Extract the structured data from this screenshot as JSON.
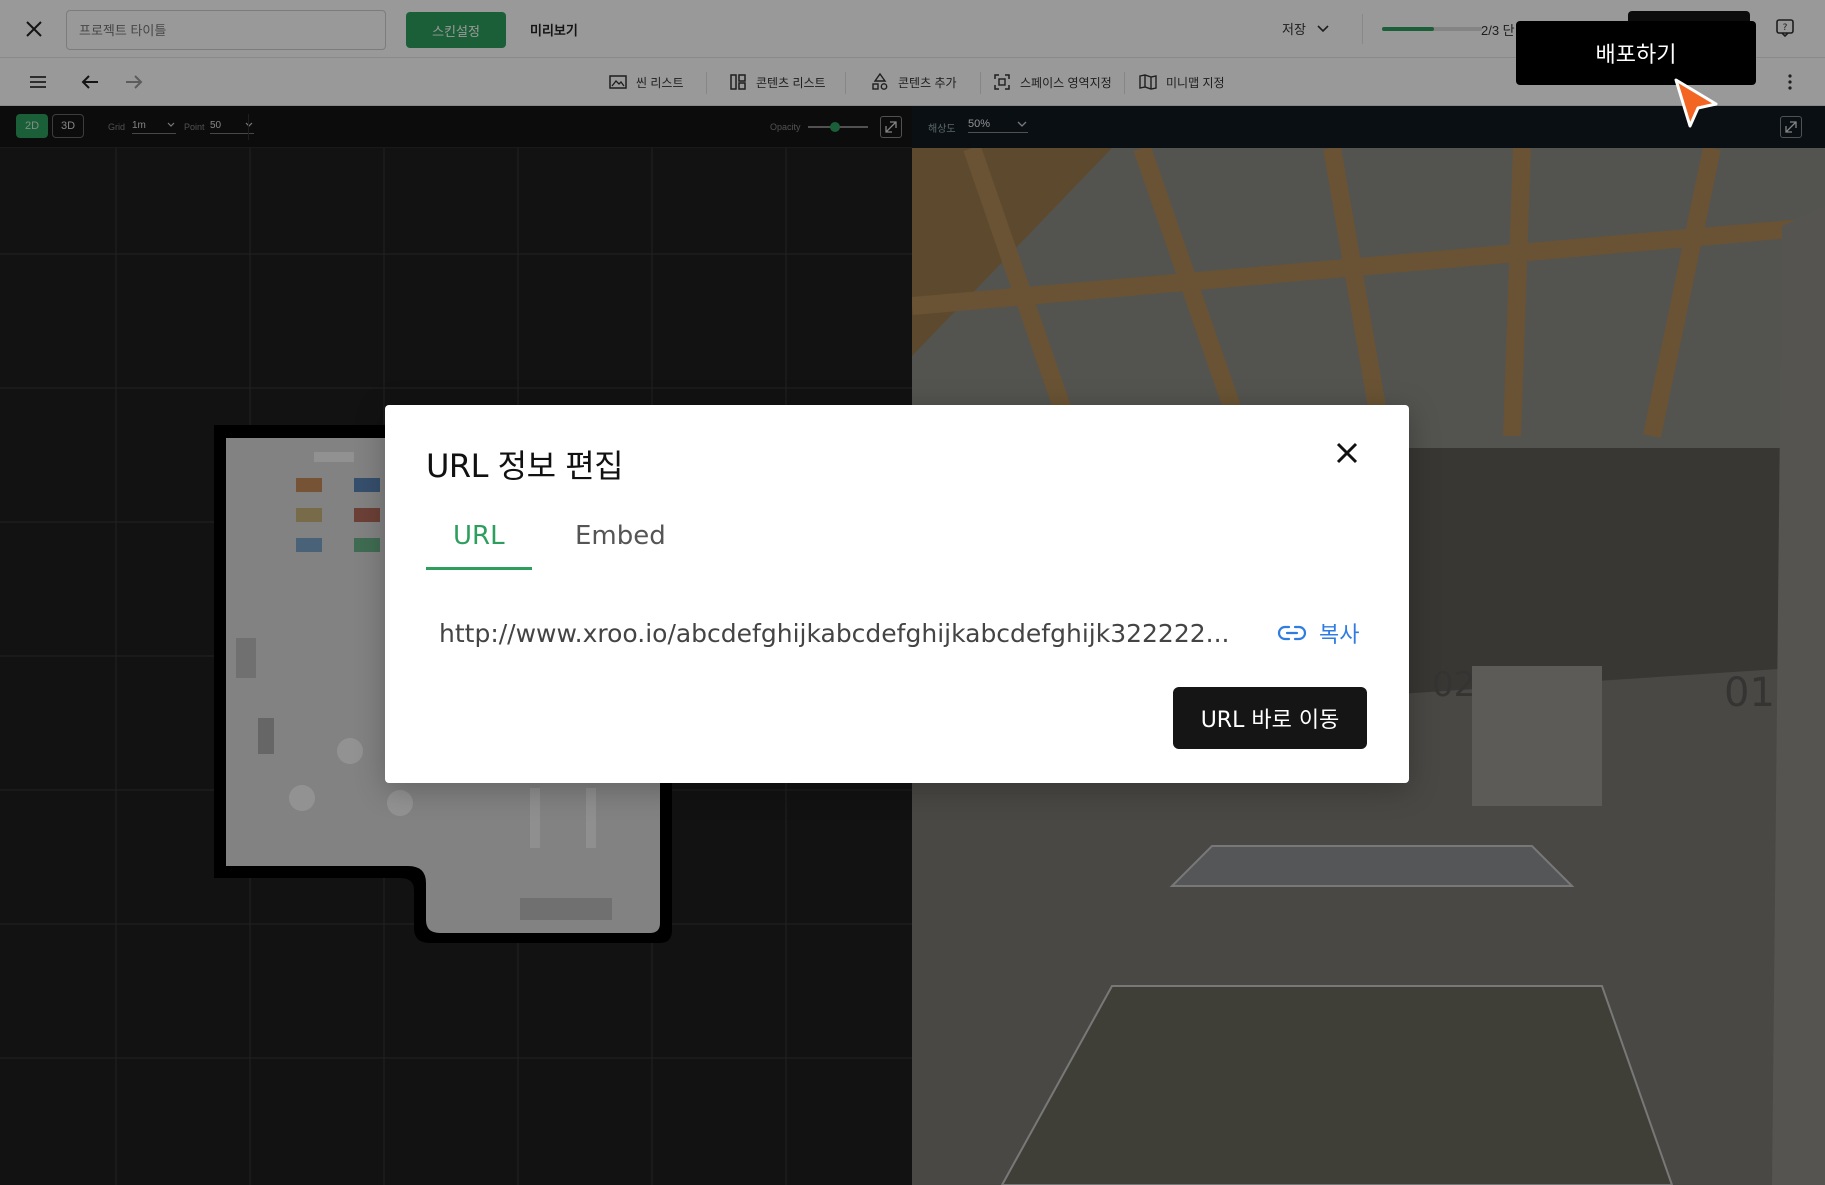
{
  "topbar": {
    "title_placeholder": "프로젝트 타이틀",
    "skin_label": "스킨설정",
    "preview_label": "미리보기",
    "save_label": "저장",
    "step_text": "2/3 단",
    "progress_fraction": 0.52
  },
  "toolbar": {
    "items": [
      {
        "label": "씬 리스트",
        "icon": "image-icon"
      },
      {
        "label": "콘텐츠 리스트",
        "icon": "layout-icon"
      },
      {
        "label": "콘텐츠 추가",
        "icon": "shapes-icon"
      },
      {
        "label": "스페이스 영역지정",
        "icon": "focus-icon"
      },
      {
        "label": "미니맵 지정",
        "icon": "map-icon"
      }
    ]
  },
  "left_controls": {
    "mode_2d": "2D",
    "mode_3d": "3D",
    "grid_label": "Grid",
    "grid_value": "1m",
    "point_label": "Point",
    "point_value": "50",
    "opacity_label": "Opacity",
    "opacity_value": 0.45
  },
  "right_controls": {
    "resolution_label": "해상도",
    "resolution_value": "50%"
  },
  "modal": {
    "title": "URL 정보 편집",
    "tabs": [
      {
        "label": "URL",
        "active": true
      },
      {
        "label": "Embed",
        "active": false
      }
    ],
    "url": "http://www.xroo.io/abcdefghijkabcdefghijkabcdefghijk322222...",
    "copy_label": "복사",
    "go_label": "URL 바로 이동"
  },
  "callout": {
    "label": "배포하기"
  },
  "colors": {
    "accent": "#2e9e5e",
    "link": "#2f7de1",
    "dark": "#151515",
    "cursor": "#f26522"
  }
}
